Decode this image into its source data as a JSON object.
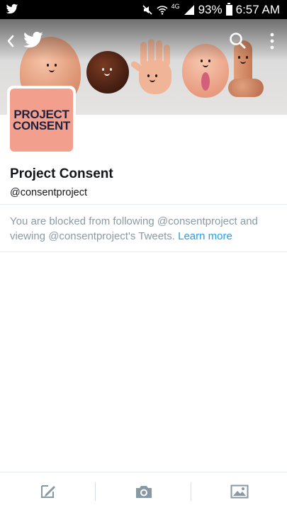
{
  "status_bar": {
    "net_label": "4G",
    "battery": "93%",
    "time": "6:57 AM"
  },
  "profile": {
    "avatar_text_line1": "PROJECT",
    "avatar_text_line2": "CONSENT",
    "name": "Project Consent",
    "handle": "@consentproject"
  },
  "blocked_notice": {
    "message": "You are blocked from following @consentproject and viewing @consentproject's Tweets.",
    "link": "Learn more"
  },
  "icons": {
    "status_app": "twitter-bird-icon",
    "back": "back-chevron-icon",
    "logo": "twitter-bird-icon",
    "search": "search-icon",
    "more": "more-vertical-icon",
    "compose": "compose-tweet-icon",
    "camera": "camera-icon",
    "gallery": "gallery-icon"
  },
  "colors": {
    "accent": "#1da1f2",
    "avatar_bg": "#f2a08d",
    "avatar_text": "#1e2240",
    "muted_text": "#8a9aa6"
  }
}
